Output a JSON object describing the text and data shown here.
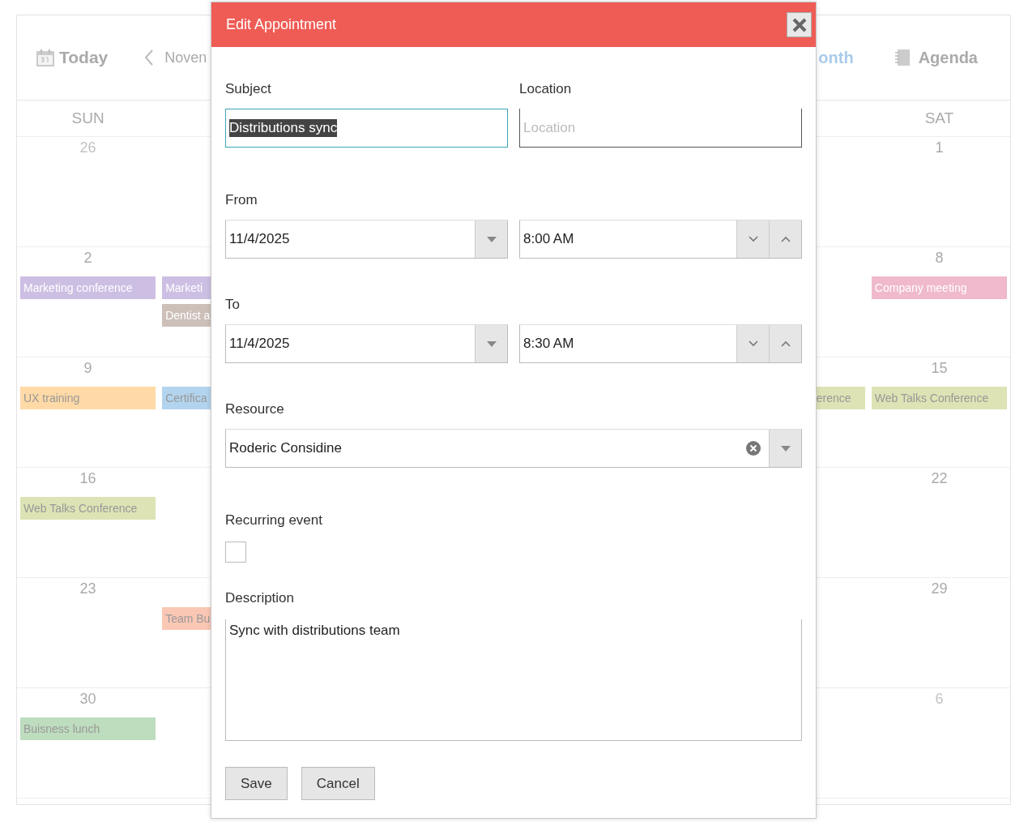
{
  "calendar": {
    "toolbar": {
      "today": "Today",
      "period": "Noven",
      "views": [
        {
          "label": "onth",
          "selected": true
        },
        {
          "label": "Agenda",
          "selected": false
        }
      ]
    },
    "day_names": {
      "sun": "SUN",
      "sat": "SAT"
    },
    "weeks": [
      {
        "sun": {
          "day": "26",
          "other_month": true
        },
        "sat": {
          "day": "1",
          "other_month": false
        }
      },
      {
        "sun": {
          "day": "2",
          "other_month": false,
          "events": [
            {
              "title": "Marketing conference",
              "color": "#cdbfe3"
            }
          ]
        },
        "mon": {
          "events": [
            {
              "title": "Marketi",
              "color": "#cdbfe3"
            },
            {
              "title": "Dentist a",
              "color": "#cdc0b9"
            }
          ]
        },
        "sat": {
          "day": "8",
          "other_month": false,
          "events": [
            {
              "title": "Company meeting",
              "color": "#f0b9cc"
            }
          ]
        }
      },
      {
        "sun": {
          "day": "9",
          "other_month": false,
          "events": [
            {
              "title": "UX training",
              "color": "#ffd9a6"
            }
          ]
        },
        "mon": {
          "events": [
            {
              "title": "Certifica",
              "color": "#b3d4ee"
            }
          ]
        },
        "fri": {
          "events": [
            {
              "title": "erence",
              "color": "#dde3b4"
            }
          ]
        },
        "sat": {
          "day": "15",
          "other_month": false,
          "events": [
            {
              "title": "Web Talks Conference",
              "color": "#dde3b4"
            }
          ]
        }
      },
      {
        "sun": {
          "day": "16",
          "other_month": false,
          "events": [
            {
              "title": "Web Talks Conference",
              "color": "#dde3b4"
            }
          ]
        },
        "sat": {
          "day": "22",
          "other_month": false
        }
      },
      {
        "sun": {
          "day": "23",
          "other_month": false
        },
        "mon": {
          "events": [
            {
              "title": "Team Bu",
              "color": "#fbc7b5"
            }
          ]
        },
        "sat": {
          "day": "29",
          "other_month": false
        }
      },
      {
        "sun": {
          "day": "30",
          "other_month": false,
          "events": [
            {
              "title": "Buisness lunch",
              "color": "#bedcbe"
            }
          ]
        },
        "sat": {
          "day": "6",
          "other_month": true
        }
      }
    ]
  },
  "dialog": {
    "title": "Edit Appointment",
    "subject": {
      "label": "Subject",
      "value": "Distributions sync",
      "focused": true,
      "text_selected": true
    },
    "location": {
      "label": "Location",
      "placeholder": "Location"
    },
    "from": {
      "label": "From",
      "date": "11/4/2025",
      "time": "8:00 AM"
    },
    "to": {
      "label": "To",
      "date": "11/4/2025",
      "time": "8:30 AM"
    },
    "resource": {
      "label": "Resource",
      "value": "Roderic Considine"
    },
    "recurring": {
      "label": "Recurring event",
      "checked": false
    },
    "description": {
      "label": "Description",
      "value": "Sync with distributions team"
    },
    "buttons": [
      {
        "label": "Save"
      },
      {
        "label": "Cancel"
      }
    ]
  }
}
